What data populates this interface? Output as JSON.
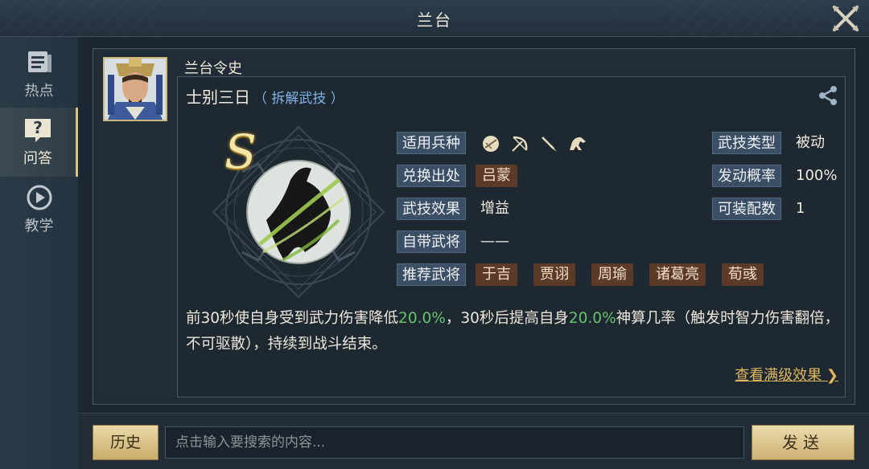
{
  "header": {
    "title": "兰台"
  },
  "sidebar": {
    "items": [
      {
        "label": "热点",
        "icon": "document-list-icon"
      },
      {
        "label": "问答",
        "icon": "question-icon",
        "active": true
      },
      {
        "label": "教学",
        "icon": "play-circle-icon"
      }
    ]
  },
  "post": {
    "author": "兰台令史",
    "skill_name": "士别三日",
    "skill_tag": "（ 拆解武技 ）",
    "grade": "S",
    "rows": {
      "troop_type": {
        "label": "适用兵种",
        "icons": [
          "shield-icon",
          "bow-icon",
          "spear-icon",
          "horse-icon"
        ]
      },
      "source": {
        "label": "兑换出处",
        "values": [
          "吕蒙"
        ]
      },
      "effect": {
        "label": "武技效果",
        "value": "增益"
      },
      "own_general": {
        "label": "自带武将",
        "value": "——"
      },
      "recommended": {
        "label": "推荐武将",
        "values": [
          "于吉",
          "贾诩",
          "周瑜",
          "诸葛亮",
          "荀彧"
        ]
      },
      "skill_type": {
        "label": "武技类型",
        "value": "被动"
      },
      "trigger_rate": {
        "label": "发动概率",
        "value": "100%"
      },
      "equip_count": {
        "label": "可装配数",
        "value": "1"
      }
    },
    "description": {
      "part1": "前30秒使自身受到武力伤害降低",
      "pct1": "20.0%",
      "part2": "，30秒后提高自身",
      "pct2": "20.0%",
      "part3": "神算几率（触发时智力伤害翻倍，不可驱散），持续到战斗结束。"
    },
    "full_effect_link": "查看满级效果 ❯"
  },
  "bottom": {
    "history_label": "历史",
    "search_placeholder": "点击输入要搜索的内容...",
    "send_label": "发送"
  },
  "colors": {
    "accent_gold": "#d8c386",
    "chip_bg": "#5b3a28",
    "label_bg": "#3a4f66",
    "pct_green": "#66c36e",
    "link": "#e0b65e"
  }
}
